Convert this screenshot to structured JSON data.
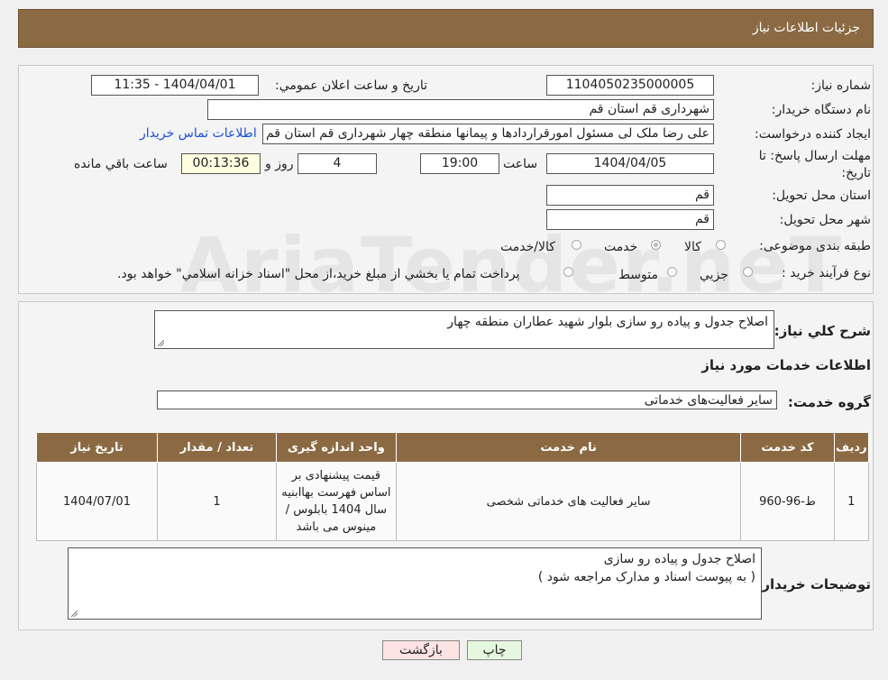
{
  "header": {
    "title": "جزئیات اطلاعات نیاز"
  },
  "labels": {
    "need_number": "شماره نیاز:",
    "announce_datetime": "تاریخ و ساعت اعلان عمومي:",
    "buyer_org": "نام دستگاه خريدار:",
    "requester": "ايجاد کننده درخواست:",
    "deadline": "مهلت ارسال پاسخ: تا تاريخ:",
    "time_word": "ساعت",
    "day_and": "روز و",
    "remaining": "ساعت باقي مانده",
    "province": "استان محل تحويل:",
    "city": "شهر محل تحويل:",
    "category": "طبقه بندی موضوعی:",
    "process": "نوع فرآيند خريد :"
  },
  "values": {
    "need_number": "1104050235000005",
    "announce_datetime": "1404/04/01 - 11:35",
    "buyer_org": "شهرداری قم استان قم",
    "requester": "علی رضا ملک لی مسئول امورقراردادها و پیمانها منطقه چهار  شهرداری قم استان قم",
    "contact_link": "اطلاعات تماس خريدار",
    "deadline_date": "1404/04/05",
    "deadline_time": "19:00",
    "days": "4",
    "remaining_time": "00:13:36",
    "province": "قم",
    "city": "قم"
  },
  "category_options": [
    "کالا",
    "خدمت",
    "کالا/خدمت"
  ],
  "category_selected": "خدمت",
  "process_options": [
    "جزيي",
    "متوسط"
  ],
  "process_note": "پرداخت تمام يا بخشي از مبلغ خريد،از محل \"اسناد خزانه اسلامي\" خواهد بود.",
  "description": {
    "label": "شرح کلي نياز:",
    "value": "اصلاح جدول و پیاده رو سازی بلوار شهید عطاران منطقه چهار"
  },
  "services_title": "اطلاعات خدمات مورد نياز",
  "service_group": {
    "label": "گروه خدمت:",
    "value": "ساير فعاليت‌هاى خدماتى"
  },
  "table": {
    "headers": [
      "رديف",
      "کد خدمت",
      "نام خدمت",
      "واحد اندازه گيری",
      "تعداد / مقدار",
      "تاريخ نياز"
    ],
    "rows": [
      [
        "1",
        "ط-96-960",
        "ساير فعاليت هاى خدماتى شخصى",
        "قیمت پیشنهادی بر اساس فهرست بهاابنیه سال 1404 بابلوس / مینوس می باشد",
        "1",
        "1404/07/01"
      ]
    ]
  },
  "buyer_notes": {
    "label": "توضيحات خريدار:",
    "line1": "اصلاح جدول و پیاده رو سازی",
    "line2": "( به پیوست اسناد و مدارک مراجعه شود )"
  },
  "buttons": {
    "print": "چاپ",
    "back": "بازگشت"
  },
  "watermark": "AriaTender.neT",
  "colors": {
    "header_bg": "#8b6a43",
    "link": "#1a4fd6",
    "back_button_bg": "#fde3e3",
    "print_button_bg": "#e6f7e0"
  }
}
